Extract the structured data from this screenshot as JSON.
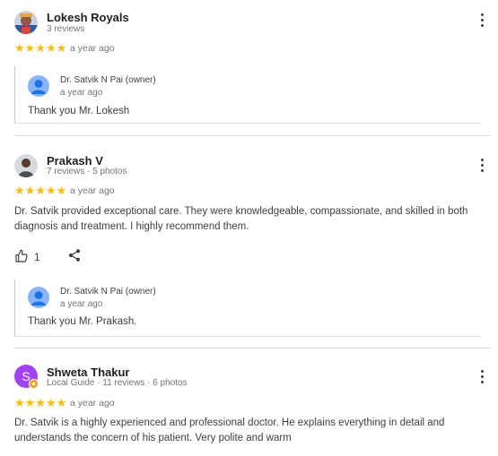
{
  "reviews": [
    {
      "name": "Lokesh Royals",
      "meta": "3 reviews",
      "stars": "★★★★★",
      "date": "a year ago",
      "reply": {
        "owner": "Dr. Satvik N Pai (owner)",
        "date": "a year ago",
        "text": "Thank you Mr. Lokesh"
      }
    },
    {
      "name": "Prakash V",
      "meta": "7 reviews · 5 photos",
      "stars": "★★★★★",
      "date": "a year ago",
      "text": "Dr. Satvik provided exceptional care. They were knowledgeable, compassionate, and skilled in both diagnosis and treatment. I highly recommend them.",
      "likes": "1",
      "reply": {
        "owner": "Dr. Satvik N Pai (owner)",
        "date": "a year ago",
        "text": "Thank you Mr. Prakash."
      }
    },
    {
      "name": "Shweta Thakur",
      "avatar_letter": "S",
      "meta": "Local Guide · 11 reviews · 6 photos",
      "stars": "★★★★★",
      "date": "a year ago",
      "text": "Dr. Satvik is a highly experienced and professional doctor. He explains everything in detail and understands the concern of his patient. Very polite and warm"
    }
  ],
  "colors": {
    "star": "#fbbc04",
    "owner_avatar": "#8ab4f8",
    "shweta_avatar": "#a142f4",
    "local_guide_badge": "#f29900"
  }
}
